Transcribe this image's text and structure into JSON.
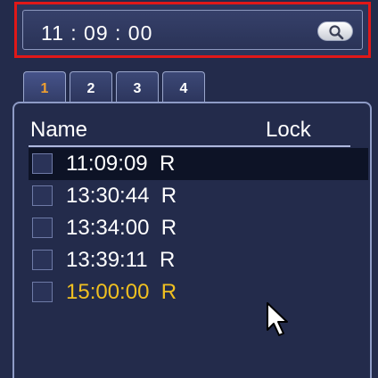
{
  "time_search": {
    "time_value": "11 : 09 : 00",
    "search_icon": "search-icon"
  },
  "tabs": [
    {
      "label": "1",
      "active": true
    },
    {
      "label": "2",
      "active": false
    },
    {
      "label": "3",
      "active": false
    },
    {
      "label": "4",
      "active": false
    }
  ],
  "file_list": {
    "columns": {
      "name": "Name",
      "lock": "Lock"
    },
    "rows": [
      {
        "label": "11:09:09  R",
        "selected": true
      },
      {
        "label": "13:30:44  R"
      },
      {
        "label": "13:34:00  R"
      },
      {
        "label": "13:39:11  R"
      },
      {
        "label": "15:00:00  R",
        "highlight_color": "#f0c020"
      }
    ]
  },
  "colors": {
    "background": "#232b4b",
    "time_box_border": "#e01818",
    "active_tab_text": "#f0a030",
    "highlight_row_text": "#f0c020"
  }
}
